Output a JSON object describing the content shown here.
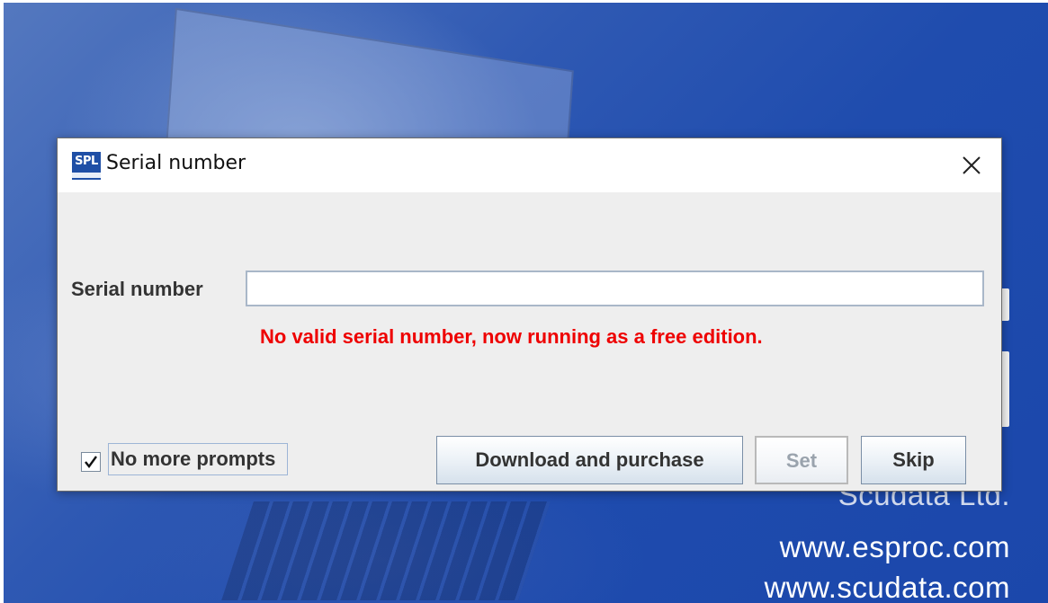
{
  "splash": {
    "company": "Scudata Ltd.",
    "url_1": "www.esproc.com",
    "url_2": "www.scudata.com"
  },
  "dialog": {
    "icon_text": "SPL",
    "title": "Serial number",
    "close_icon": "close-icon",
    "serial_label": "Serial number",
    "serial_value": "",
    "warning": "No valid serial number, now running as a free edition.",
    "no_more_prompts_label": "No more prompts",
    "no_more_prompts_checked": true,
    "buttons": {
      "download_label": "Download and purchase",
      "set_label": "Set",
      "skip_label": "Skip"
    }
  },
  "colors": {
    "warning": "#ee0000",
    "splash_background": "#1f4cae",
    "dialog_background": "#eeeeee"
  }
}
